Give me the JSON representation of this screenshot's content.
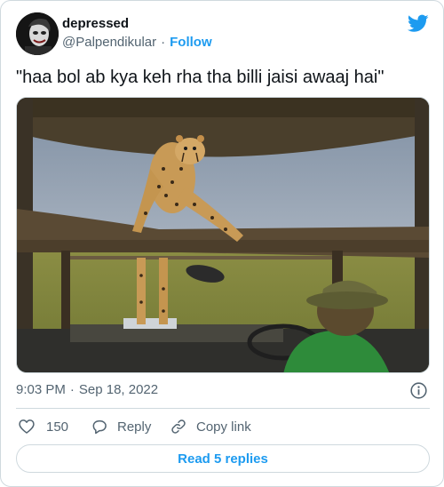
{
  "author": {
    "display_name": "depressed",
    "handle": "@Palpendikular",
    "separator": "·",
    "follow_label": "Follow"
  },
  "tweet": {
    "text": "\"haa bol ab kya keh rha tha billi jaisi awaaj hai\"",
    "time": "9:03 PM",
    "separator": "·",
    "date": "Sep 18, 2022"
  },
  "actions": {
    "like_count": "150",
    "reply_label": "Reply",
    "copy_label": "Copy link"
  },
  "replies_button": "Read 5 replies",
  "colors": {
    "accent": "#1d9bf0",
    "text": "#0f1419",
    "secondary": "#536471",
    "border": "#cfd9de"
  },
  "icons": {
    "brand": "twitter-bird-icon",
    "info": "info-icon",
    "like": "heart-icon",
    "reply": "reply-bubble-icon",
    "copy": "link-icon"
  }
}
